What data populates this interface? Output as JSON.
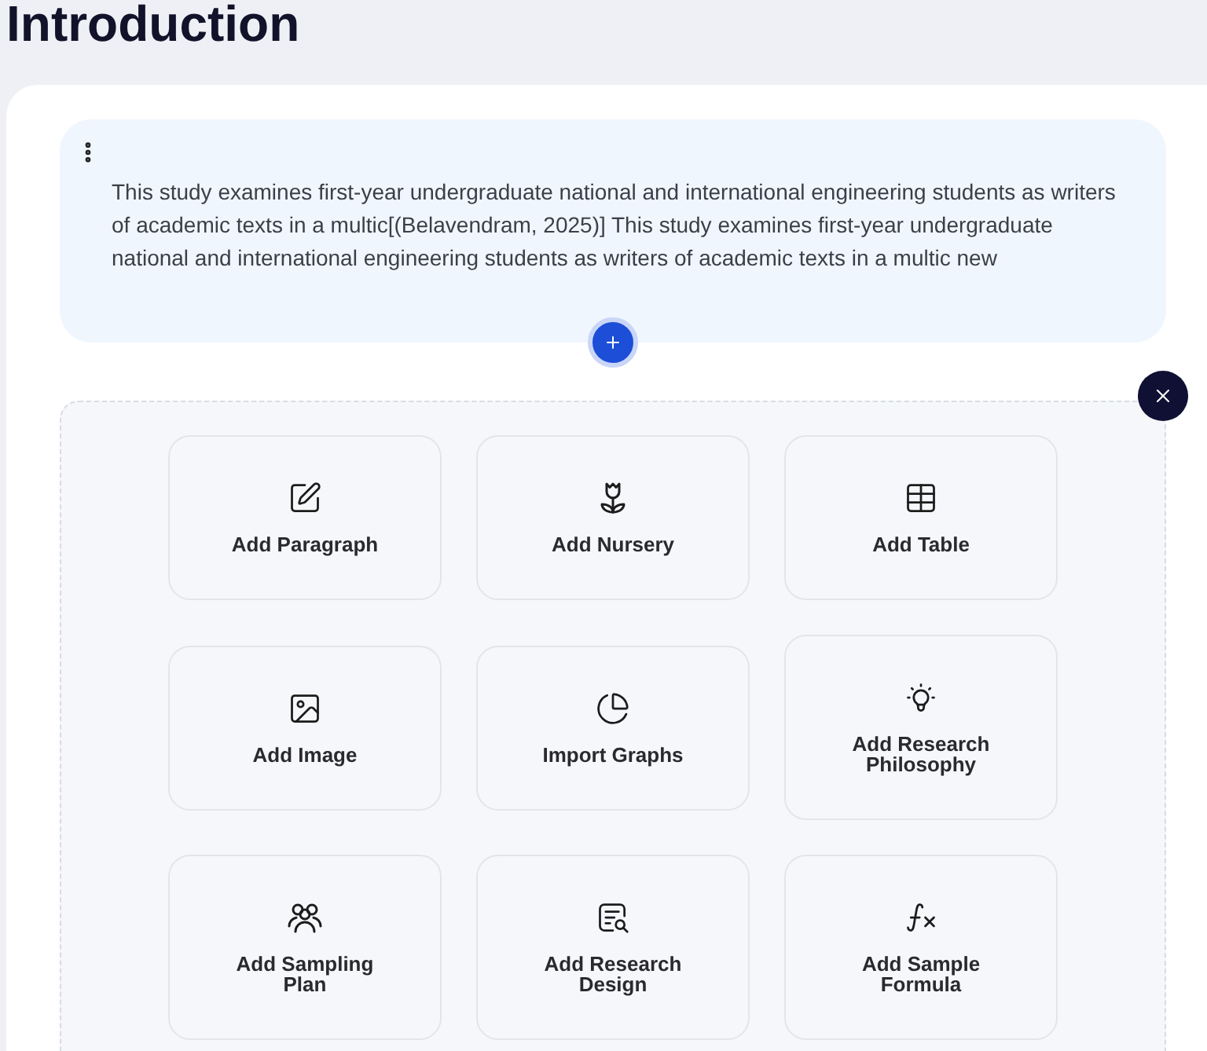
{
  "heading": "Introduction",
  "paragraph_block": {
    "text": "This study examines first-year undergraduate national and international engineering students as writers of academic texts in a multic[(Belavendram, 2025)] This study examines first-year undergraduate national and international engineering students as writers of academic texts in a multic new"
  },
  "block_menu": {
    "items": [
      {
        "label": "Add Paragraph"
      },
      {
        "label": "Add Nursery"
      },
      {
        "label": "Add Table"
      },
      {
        "label": "Add Image"
      },
      {
        "label": "Import Graphs"
      },
      {
        "label": "Add Research Philosophy"
      },
      {
        "label": "Add Sampling Plan"
      },
      {
        "label": "Add Research Design"
      },
      {
        "label": "Add Sample Formula"
      }
    ]
  }
}
